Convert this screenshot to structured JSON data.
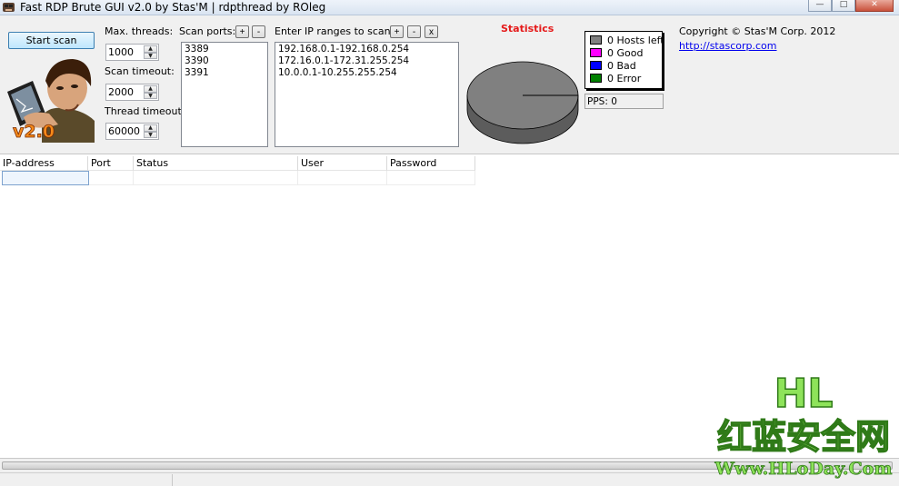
{
  "window": {
    "title": "Fast RDP Brute GUI v2.0 by Stas'M | rdpthread by ROleg"
  },
  "controls": {
    "start_label": "Start scan",
    "max_threads_label": "Max. threads:",
    "max_threads_value": "1000",
    "scan_timeout_label": "Scan timeout:",
    "scan_timeout_value": "2000",
    "thread_timeout_label": "Thread timeout:",
    "thread_timeout_value": "60000"
  },
  "logo": {
    "badge": "v2.0"
  },
  "ports": {
    "label": "Scan ports:",
    "add": "+",
    "remove": "-",
    "items": [
      "3389",
      "3390",
      "3391"
    ]
  },
  "ranges": {
    "label": "Enter IP ranges to scan:",
    "add": "+",
    "remove": "-",
    "clear": "x",
    "items": [
      "192.168.0.1-192.168.0.254",
      "172.16.0.1-172.31.255.254",
      "10.0.0.1-10.255.255.254"
    ]
  },
  "stats": {
    "title": "Statistics",
    "legend": [
      {
        "label": "0 Hosts left",
        "color": "#808080"
      },
      {
        "label": "0 Good",
        "color": "#ff00ff"
      },
      {
        "label": "0 Bad",
        "color": "#0000ff"
      },
      {
        "label": "0 Error",
        "color": "#008000"
      }
    ],
    "pps": "PPS: 0",
    "title_color": "#e51a1a"
  },
  "about": {
    "copyright": "Copyright © Stas'M Corp. 2012",
    "link": "http://stascorp.com"
  },
  "table": {
    "columns": [
      "IP-address",
      "Port",
      "Status",
      "User",
      "Password"
    ]
  },
  "watermark": {
    "line1": "HL",
    "line2": "红蓝安全网",
    "line3": "Www.HLoDay.Com"
  }
}
